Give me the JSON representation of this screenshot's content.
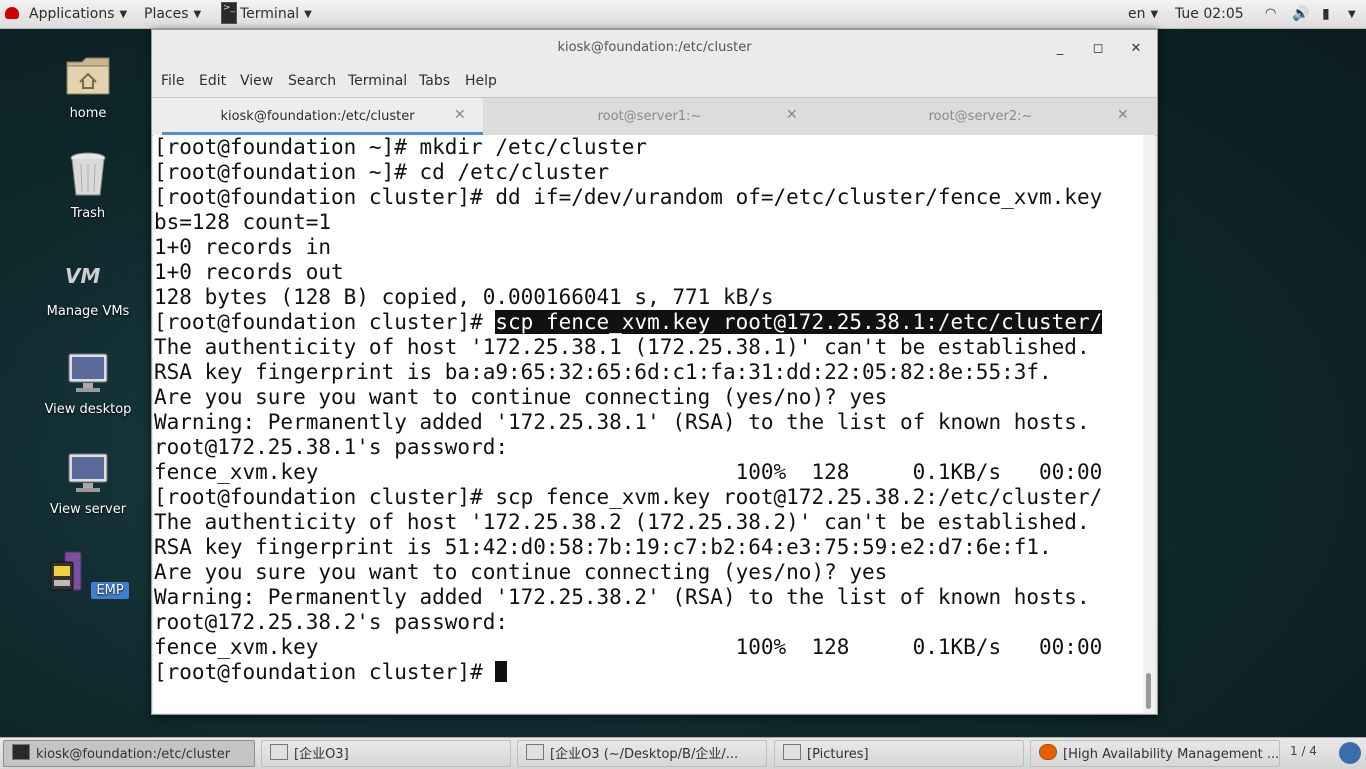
{
  "topbar": {
    "applications": "Applications",
    "places": "Places",
    "terminal": "Terminal",
    "lang": "en",
    "clock": "Tue 02:05"
  },
  "desktop": {
    "icons": [
      {
        "label": "home",
        "icon": "home-folder-icon"
      },
      {
        "label": "Trash",
        "icon": "trash-icon"
      },
      {
        "label": "Manage VMs",
        "icon": "vm-icon"
      },
      {
        "label": "View desktop",
        "icon": "monitor-icon"
      },
      {
        "label": "View server",
        "icon": "monitor-icon"
      },
      {
        "label": "EMP",
        "icon": "emp-icon"
      }
    ]
  },
  "window": {
    "title": "kiosk@foundation:/etc/cluster",
    "menu": [
      "File",
      "Edit",
      "View",
      "Search",
      "Terminal",
      "Tabs",
      "Help"
    ],
    "tabs": [
      {
        "label": "kiosk@foundation:/etc/cluster",
        "active": true
      },
      {
        "label": "root@server1:~",
        "active": false
      },
      {
        "label": "root@server2:~",
        "active": false
      }
    ]
  },
  "terminal": {
    "lines": [
      "[root@foundation ~]# mkdir /etc/cluster",
      "[root@foundation ~]# cd /etc/cluster",
      "[root@foundation cluster]# dd if=/dev/urandom of=/etc/cluster/fence_xvm.key",
      "bs=128 count=1",
      "1+0 records in",
      "1+0 records out",
      "128 bytes (128 B) copied, 0.000166041 s, 771 kB/s",
      "[root@foundation cluster]# ",
      "The authenticity of host '172.25.38.1 (172.25.38.1)' can't be established.",
      "RSA key fingerprint is ba:a9:65:32:65:6d:c1:fa:31:dd:22:05:82:8e:55:3f.",
      "Are you sure you want to continue connecting (yes/no)? yes",
      "Warning: Permanently added '172.25.38.1' (RSA) to the list of known hosts.",
      "root@172.25.38.1's password:",
      "fence_xvm.key                                 100%  128     0.1KB/s   00:00",
      "[root@foundation cluster]# scp fence_xvm.key root@172.25.38.2:/etc/cluster/",
      "The authenticity of host '172.25.38.2 (172.25.38.2)' can't be established.",
      "RSA key fingerprint is 51:42:d0:58:7b:19:c7:b2:64:e3:75:59:e2:d7:6e:f1.",
      "Are you sure you want to continue connecting (yes/no)? yes",
      "Warning: Permanently added '172.25.38.2' (RSA) to the list of known hosts.",
      "root@172.25.38.2's password:",
      "fence_xvm.key                                 100%  128     0.1KB/s   00:00",
      "[root@foundation cluster]# "
    ],
    "highlighted": "scp fence_xvm.key root@172.25.38.1:/etc/cluster/"
  },
  "taskbar": {
    "items": [
      "kiosk@foundation:/etc/cluster",
      "[企业O3]",
      "[企业O3 (~/Desktop/B/企业/...",
      "[Pictures]",
      "[High Availability Management ..."
    ],
    "pager": "1 / 4"
  }
}
